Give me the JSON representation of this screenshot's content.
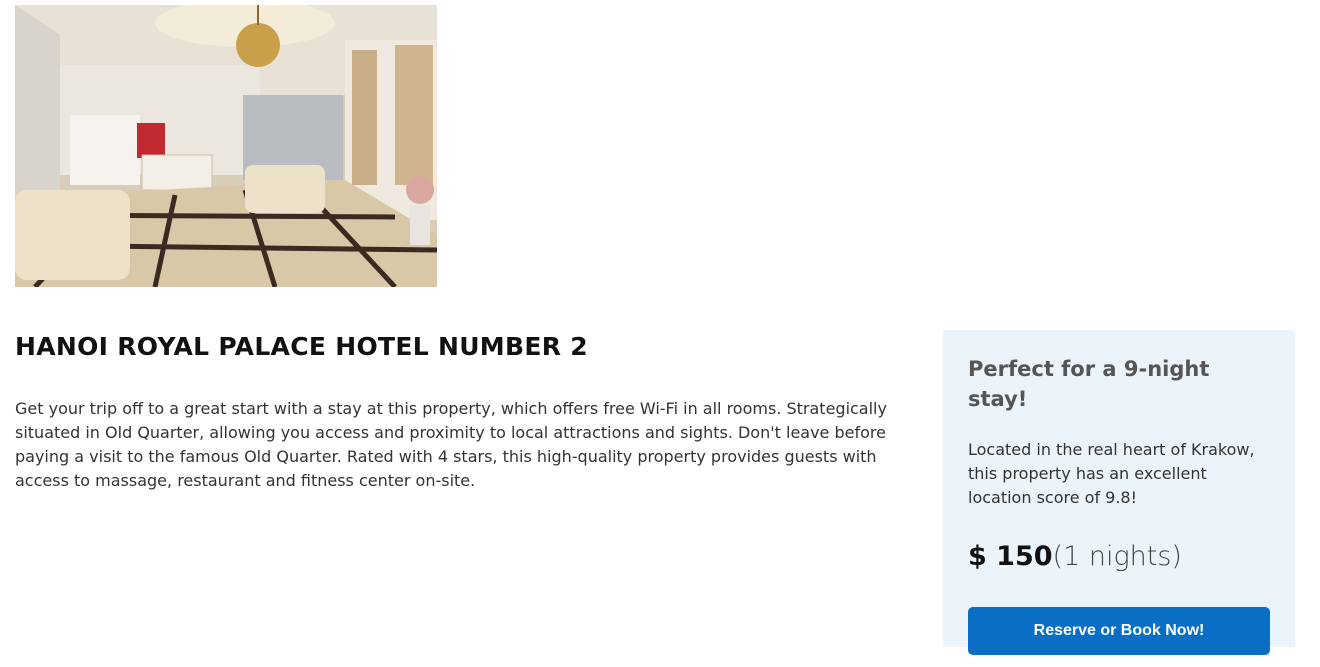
{
  "hotel": {
    "name": "HANOI ROYAL PALACE HOTEL NUMBER 2",
    "description": "Get your trip off to a great start with a stay at this property, which offers free Wi-Fi in all rooms. Strategically situated in Old Quarter, allowing you access and proximity to local attractions and sights. Don't leave before paying a visit to the famous Old Quarter. Rated with 4 stars, this high-quality property provides guests with access to massage, restaurant and fitness center on-site."
  },
  "booking_panel": {
    "heading": "Perfect for a 9-night stay!",
    "text": "Located in the real heart of Krakow, this property has an excellent location score of 9.8!",
    "price": "$ 150",
    "nights": "(1 nights)",
    "button_label": "Reserve or Book Now!"
  },
  "colors": {
    "panel_background": "#ebf3fb",
    "button": "#0a6ec5"
  }
}
